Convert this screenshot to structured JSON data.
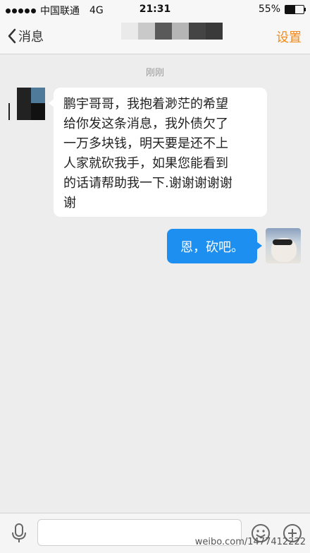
{
  "status_bar": {
    "carrier": "中国联通",
    "network": "4G",
    "time": "21:31",
    "battery": "55%",
    "battery_level": 0.55
  },
  "nav": {
    "back_label": "消息",
    "settings_label": "设置"
  },
  "chat": {
    "timestamp": "刚刚",
    "incoming_lines": [
      "鹏宇哥哥，我抱着渺茫的希望",
      "给你发这条消息，我外债欠了",
      "一万多块钱，明天要是还不上",
      "人家就砍我手，如果您能看到",
      "的话请帮助我一下.谢谢谢谢谢",
      "谢"
    ],
    "outgoing_text": "恩，砍吧。"
  },
  "input_bar": {
    "input_value": ""
  },
  "watermark": "weibo.com/1477412222",
  "colors": {
    "accent_orange": "#f08a1c",
    "outgoing_bubble": "#1c8ff0",
    "background": "#ededed"
  }
}
